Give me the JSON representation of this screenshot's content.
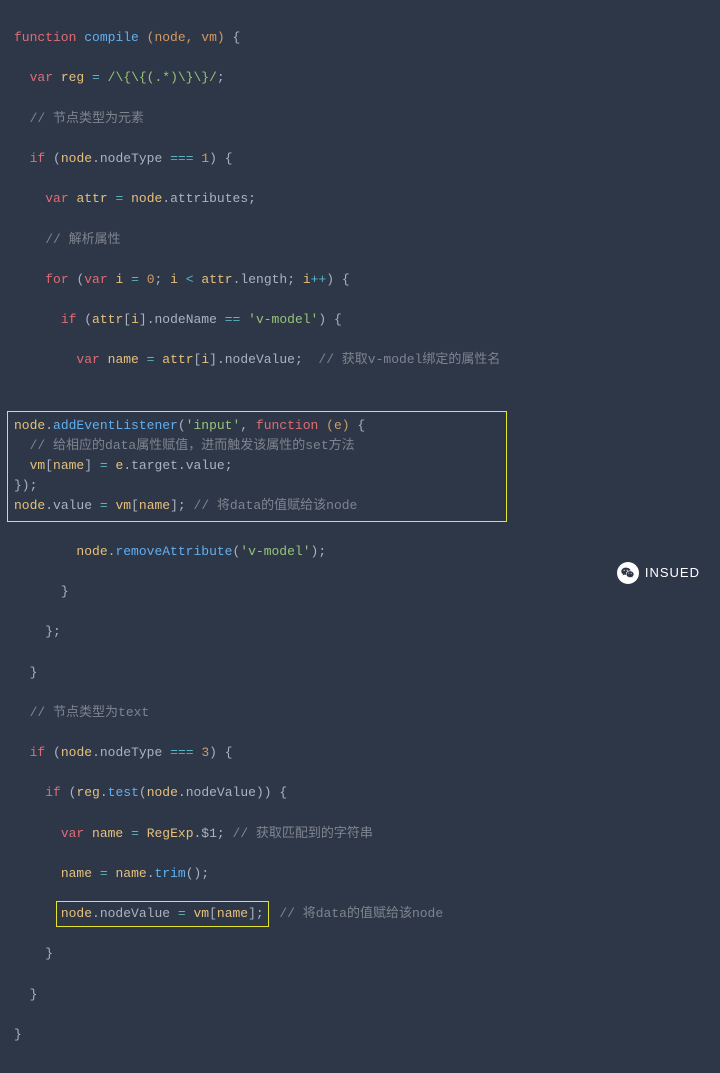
{
  "code": {
    "l1": {
      "t1": "function",
      "t2": "compile",
      "t3": "(node, vm)",
      "t4": "{"
    },
    "l2": {
      "t1": "var",
      "t2": "reg",
      "t3": "=",
      "t4": "/\\{\\{(.*)\\}\\}/",
      "t5": ";"
    },
    "l3": {
      "t1": "// 节点类型为元素"
    },
    "l4": {
      "t1": "if",
      "t2": "(",
      "t3": "node",
      "t4": ".nodeType",
      "t5": "===",
      "t6": "1",
      "t7": ") {"
    },
    "l5": {
      "t1": "var",
      "t2": "attr",
      "t3": "=",
      "t4": "node",
      "t5": ".attributes",
      "t6": ";"
    },
    "l6": {
      "t1": "// 解析属性"
    },
    "l7": {
      "t1": "for",
      "t2": "(",
      "t3": "var",
      "t4": "i",
      "t5": "=",
      "t6": "0",
      "t7": ";",
      "t8": "i",
      "t9": "<",
      "t10": "attr",
      "t11": ".length",
      "t12": ";",
      "t13": "i",
      "t14": "++",
      "t15": ") {"
    },
    "l8": {
      "t1": "if",
      "t2": "(",
      "t3": "attr",
      "t4": "[",
      "t5": "i",
      "t6": "].nodeName",
      "t7": "==",
      "t8": "'v-model'",
      "t9": ") {"
    },
    "l9": {
      "t1": "var",
      "t2": "name",
      "t3": "=",
      "t4": "attr",
      "t5": "[",
      "t6": "i",
      "t7": "].nodeValue",
      "t8": ";",
      "t9": "// 获取v-model绑定的属性名"
    },
    "l10": {
      "t1": "node",
      "t2": ".",
      "t3": "addEventListener",
      "t4": "(",
      "t5": "'input'",
      "t6": ",",
      "t7": "function",
      "t8": "(e)",
      "t9": "{"
    },
    "l11": {
      "t1": "// 给相应的data属性赋值，进而触发该属性的set方法"
    },
    "l12": {
      "t1": "vm",
      "t2": "[",
      "t3": "name",
      "t4": "]",
      "t5": "=",
      "t6": "e",
      "t7": ".target.value",
      "t8": ";"
    },
    "l13": {
      "t1": "});"
    },
    "l14": {
      "t1": "node",
      "t2": ".value",
      "t3": "=",
      "t4": "vm",
      "t5": "[",
      "t6": "name",
      "t7": "];",
      "t8": "// 将data的值赋给该node"
    },
    "l15": {
      "t1": "node",
      "t2": ".",
      "t3": "removeAttribute",
      "t4": "(",
      "t5": "'v-model'",
      "t6": ");"
    },
    "l16": {
      "t1": "}"
    },
    "l17": {
      "t1": "};"
    },
    "l18": {
      "t1": "}"
    },
    "l19": {
      "t1": "// 节点类型为text"
    },
    "l20": {
      "t1": "if",
      "t2": "(",
      "t3": "node",
      "t4": ".nodeType",
      "t5": "===",
      "t6": "3",
      "t7": ") {"
    },
    "l21": {
      "t1": "if",
      "t2": "(",
      "t3": "reg",
      "t4": ".",
      "t5": "test",
      "t6": "(",
      "t7": "node",
      "t8": ".nodeValue",
      "t9": ")) {"
    },
    "l22": {
      "t1": "var",
      "t2": "name",
      "t3": "=",
      "t4": "RegExp",
      "t5": ".$1",
      "t6": ";",
      "t7": "// 获取匹配到的字符串"
    },
    "l23": {
      "t1": "name",
      "t2": "=",
      "t3": "name",
      "t4": ".",
      "t5": "trim",
      "t6": "();"
    },
    "l24": {
      "t1": "node",
      "t2": ".nodeValue",
      "t3": "=",
      "t4": "vm",
      "t5": "[",
      "t6": "name",
      "t7": "];",
      "t8": "// 将data的值赋给该node"
    },
    "l25": {
      "t1": "}"
    },
    "l26": {
      "t1": "}"
    },
    "l27": {
      "t1": "}"
    }
  },
  "watermark": {
    "label": "INSUED"
  }
}
